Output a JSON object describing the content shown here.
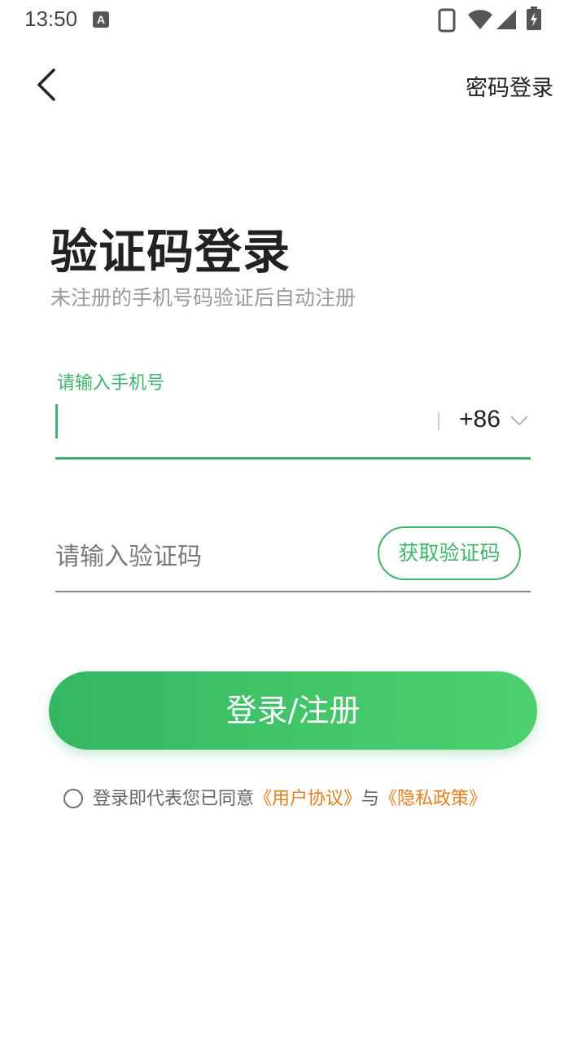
{
  "status_bar": {
    "time": "13:50",
    "notification_letter": "A",
    "icons": [
      "phone-icon",
      "wifi-icon",
      "signal-icon",
      "battery-charging-icon"
    ]
  },
  "header": {
    "back_icon": "chevron-left-icon",
    "action_label": "密码登录"
  },
  "page": {
    "title": "验证码登录",
    "subtitle": "未注册的手机号码验证后自动注册"
  },
  "phone_field": {
    "label": "请输入手机号",
    "value": "",
    "country_code": "+86",
    "dropdown_icon": "chevron-down-icon"
  },
  "code_field": {
    "placeholder": "请输入验证码",
    "value": "",
    "get_code_label": "获取验证码"
  },
  "login_button": {
    "label": "登录/注册"
  },
  "agreement": {
    "checked": false,
    "prefix": "登录即代表您已同意",
    "terms_link": "《用户协议》",
    "connector": "与",
    "privacy_link": "《隐私政策》"
  },
  "colors": {
    "accent": "#3db36b",
    "button_gradient_start": "#34b763",
    "button_gradient_end": "#4fd06f",
    "link": "#e67e1e",
    "subtitle": "#9a9a9a"
  }
}
